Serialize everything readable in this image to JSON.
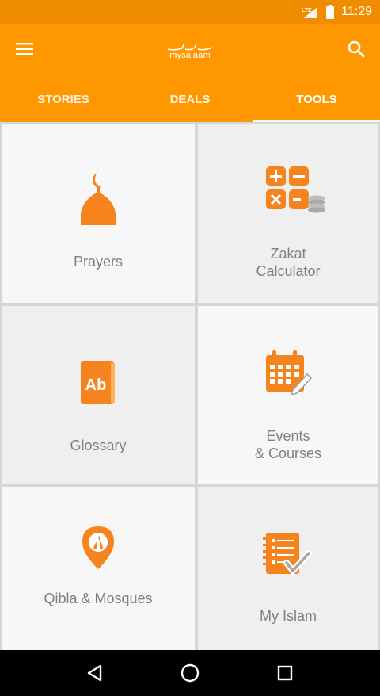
{
  "status_bar": {
    "network": "LTE",
    "time": "11:29"
  },
  "app_bar": {
    "logo_text": "mysalaam",
    "menu_icon": "hamburger-menu-icon",
    "search_icon": "search-icon"
  },
  "tabs": [
    {
      "label": "STORIES",
      "active": false
    },
    {
      "label": "DEALS",
      "active": false
    },
    {
      "label": "TOOLS",
      "active": true
    }
  ],
  "tiles": [
    {
      "label": "Prayers",
      "icon": "mosque-icon"
    },
    {
      "label": "Zakat\nCalculator",
      "icon": "calculator-coins-icon"
    },
    {
      "label": "Glossary",
      "icon": "book-ab-icon"
    },
    {
      "label": "Events\n& Courses",
      "icon": "calendar-pencil-icon"
    },
    {
      "label": "Qibla & Mosques",
      "icon": "location-pin-icon"
    },
    {
      "label": "My Islam",
      "icon": "checklist-icon"
    }
  ],
  "colors": {
    "accent": "#ff9800",
    "status_bar": "#ef8c00",
    "icon": "#f5841f",
    "tile_text": "#7f7f7f"
  },
  "nav_bar": {
    "back_icon": "back-triangle-icon",
    "home_icon": "home-circle-icon",
    "recents_icon": "recents-square-icon"
  }
}
